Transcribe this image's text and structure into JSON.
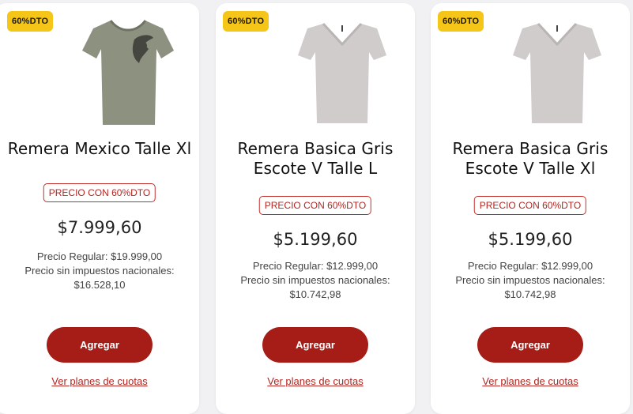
{
  "products": [
    {
      "badge": "60%DTO",
      "title_lines": [
        "Remera Mexico Talle Xl",
        ""
      ],
      "promo": "PRECIO CON 60%DTO",
      "price": "$7.999,60",
      "regular": "Precio Regular: $19.999,00",
      "tax_label": "Precio sin impuestos nacionales:",
      "tax_value": "$16.528,10",
      "button": "Agregar",
      "link": "Ver planes de cuotas",
      "shirt_color": "#8d9180",
      "image": "olive-tshirt-with-eagle-print"
    },
    {
      "badge": "60%DTO",
      "title_lines": [
        "Remera Basica Gris",
        "Escote V Talle L"
      ],
      "promo": "PRECIO CON 60%DTO",
      "price": "$5.199,60",
      "regular": "Precio Regular: $12.999,00",
      "tax_label": "Precio sin impuestos nacionales:",
      "tax_value": "$10.742,98",
      "button": "Agregar",
      "link": "Ver planes de cuotas",
      "shirt_color": "#cfcccb",
      "image": "gray-vneck-tshirt"
    },
    {
      "badge": "60%DTO",
      "title_lines": [
        "Remera Basica Gris",
        "Escote V Talle Xl"
      ],
      "promo": "PRECIO CON 60%DTO",
      "price": "$5.199,60",
      "regular": "Precio Regular: $12.999,00",
      "tax_label": "Precio sin impuestos nacionales:",
      "tax_value": "$10.742,98",
      "button": "Agregar",
      "link": "Ver planes de cuotas",
      "shirt_color": "#cfcccb",
      "image": "gray-vneck-tshirt"
    }
  ]
}
